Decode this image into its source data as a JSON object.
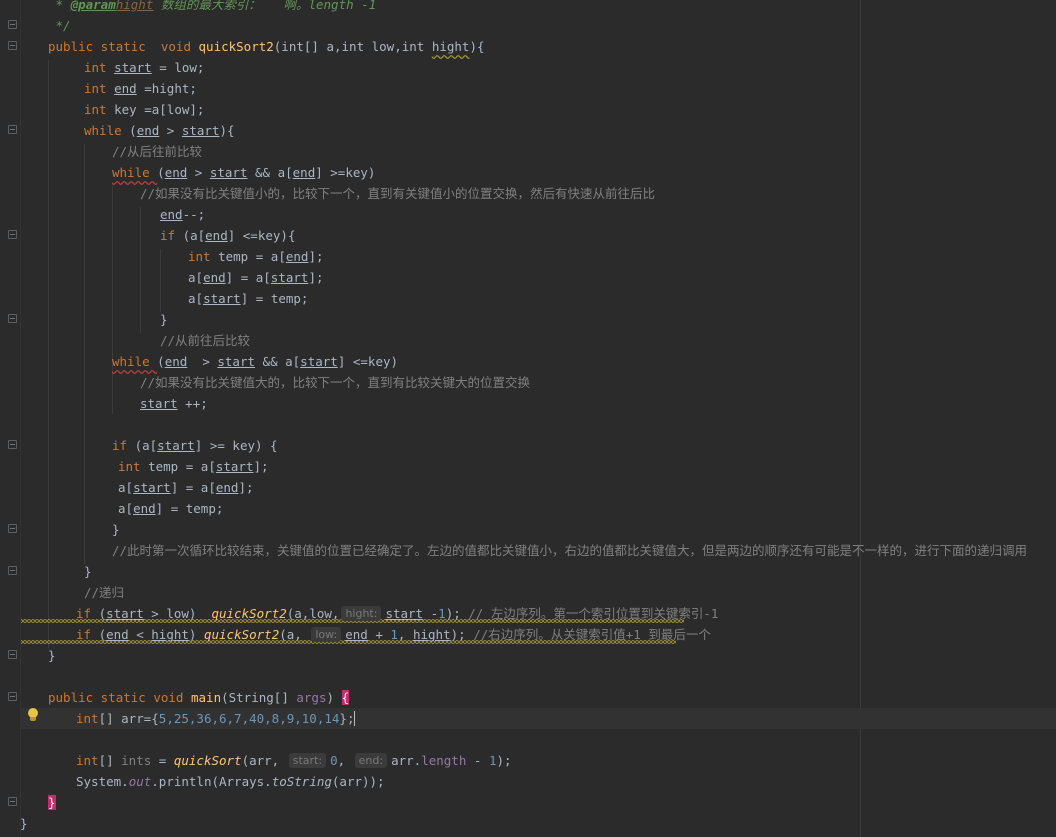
{
  "editor": {
    "line1": {
      "star": " * ",
      "tag": "@param",
      "param": "hight",
      "desc": " 数组的最大索引：   啊。length -1"
    },
    "line2": " */",
    "line3": {
      "kw": "public static  void ",
      "fn": "quickSort2",
      "params": "(int[] a,int low,int ",
      "hight": "hight",
      "end": "){"
    },
    "line4": {
      "kw": "int ",
      "var": "start",
      "rest": " = low;"
    },
    "line5": {
      "kw": "int ",
      "var": "end",
      "rest": " =hight;"
    },
    "line6": {
      "kw": "int ",
      "var": "key",
      "rest": " =a[low];"
    },
    "line7": {
      "kw": "while ",
      "a": "(",
      "v1": "end",
      "op": " > ",
      "v2": "start",
      "end": "){"
    },
    "line8": "//从后往前比较",
    "line9": {
      "kw": "while ",
      "a": "(",
      "v1": "end",
      "op": " > ",
      "v2": "start",
      "op2": " && a[",
      "v3": "end",
      "end": "] >=key)"
    },
    "line10": "//如果没有比关键值小的，比较下一个，直到有关键值小的位置交换，然后有快速从前往后比",
    "line11": {
      "v": "end",
      "rest": "--;"
    },
    "line12": {
      "kw": "if ",
      "a": "(a[",
      "v": "end",
      "end": "] <=key){"
    },
    "line13": {
      "kw": "int ",
      "var": "temp",
      "a": " = a[",
      "v": "end",
      "end": "];"
    },
    "line14": {
      "a": "a[",
      "v1": "end",
      "b": "] = a[",
      "v2": "start",
      "end": "];"
    },
    "line15": {
      "a": "a[",
      "v": "start",
      "b": "] = ",
      "t": "temp",
      "end": ";"
    },
    "line16": "}",
    "line17": "//从前往后比较",
    "line18": {
      "kw": "while ",
      "a": "(",
      "v1": "end",
      "op": "  > ",
      "v2": "start",
      "op2": " && a[",
      "v3": "start",
      "end": "] <=key)"
    },
    "line19": "//如果没有比关键值大的，比较下一个，直到有比较关键大的位置交换",
    "line20": {
      "v": "start",
      "rest": " ++;"
    },
    "line21": {
      "kw": "if ",
      "a": "(a[",
      "v": "start",
      "end": "] >= key) {"
    },
    "line22": {
      "kw": "int ",
      "var": "temp",
      "a": " = a[",
      "v": "start",
      "end": "];"
    },
    "line23": {
      "a": "a[",
      "v1": "start",
      "b": "] = a[",
      "v2": "end",
      "end": "];"
    },
    "line24": {
      "a": "a[",
      "v": "end",
      "b": "] = ",
      "t": "temp",
      "end": ";"
    },
    "line25": "}",
    "line26": "//此时第一次循环比较结束，关键值的位置已经确定了。左边的值都比关键值小，右边的值都比关键值大，但是两边的顺序还有可能是不一样的，进行下面的递归调用",
    "line27": "}",
    "line28": "//递归",
    "line29": {
      "kw": "if ",
      "a": "(",
      "v": "start",
      "b": " > low)  ",
      "fn": "quickSort2",
      "c": "(a,low,",
      "hint": "hight:",
      "v2": "start",
      "d": " -",
      "num": "1",
      "e": "); ",
      "cm": "// 左边序列。第一个索引位置到关键索引-1"
    },
    "line30": {
      "kw": "if ",
      "a": "(",
      "v": "end",
      "b": " < ",
      "h": "hight",
      "c": ") ",
      "fn": "quickSort2",
      "d": "(a, ",
      "hint": "low:",
      "v2": "end",
      "e": " + ",
      "num": "1",
      "f": ", ",
      "h2": "hight",
      "g": "); ",
      "cm": "//右边序列。从关键索引值+1 到最后一个"
    },
    "line31": "}",
    "line32": {
      "kw": "public static void ",
      "fn": "main",
      "a": "(String[] ",
      "args": "args",
      "b": ") ",
      "brace": "{"
    },
    "line33": {
      "kw": "int",
      "a": "[] arr={",
      "nums": "5,25,36,6,7,40,8,9,10,14",
      "b": "};"
    },
    "line34": {
      "kw": "int",
      "a": "[] ",
      "ints": "ints",
      "b": " = ",
      "fn": "quickSort",
      "c": "(arr, ",
      "hint1": "start:",
      "n0": "0",
      "d": ", ",
      "hint2": "end:",
      "e": "arr.",
      "len": "length",
      "f": " - ",
      "n1": "1",
      "g": ");"
    },
    "line35": {
      "a": "System.",
      "out": "out",
      "b": ".println(Arrays.",
      "fn": "toString",
      "c": "(arr));"
    },
    "line36": "}",
    "line37": "}"
  },
  "icons": {
    "fold": "fold-marker-icon",
    "bulb": "lightbulb-icon"
  },
  "colors": {
    "background": "#2b2b2b",
    "keyword": "#cc7832",
    "method": "#ffc66d",
    "field": "#9876aa",
    "number": "#6897bb",
    "comment": "#808080"
  }
}
